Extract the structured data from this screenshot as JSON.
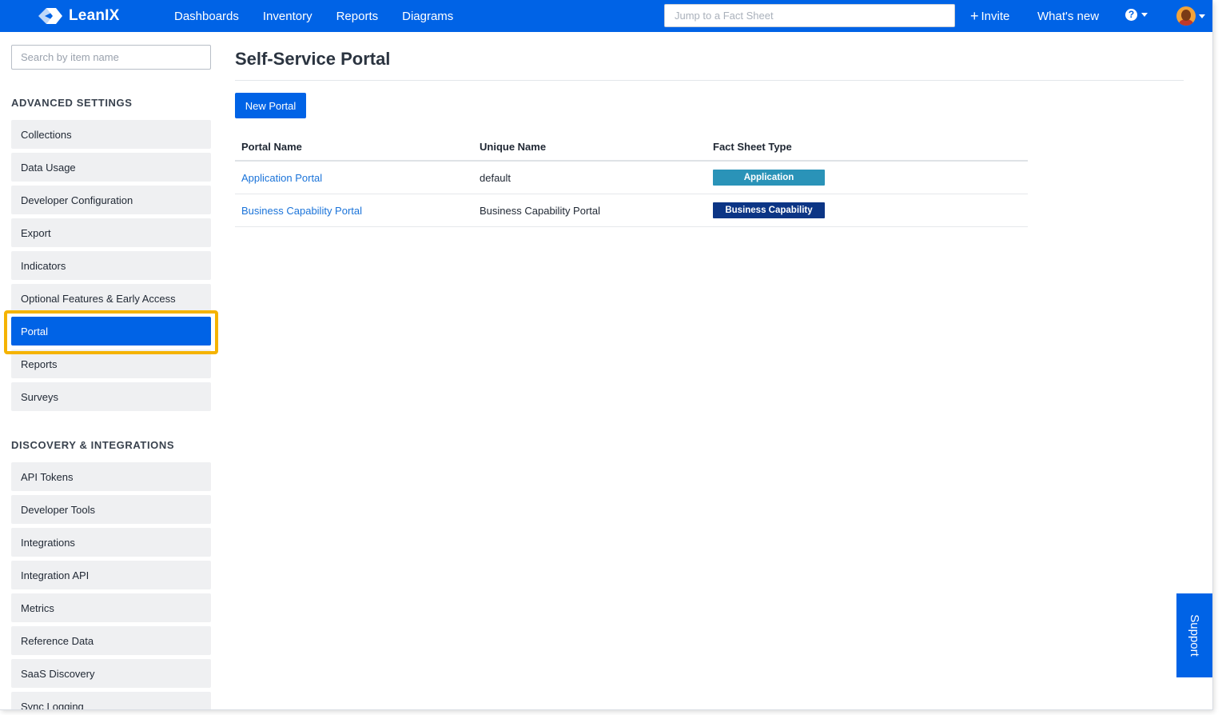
{
  "app": {
    "logo_text": "LeanIX",
    "nav": [
      "Dashboards",
      "Inventory",
      "Reports",
      "Diagrams"
    ],
    "jump_placeholder": "Jump to a Fact Sheet",
    "invite_label": "Invite",
    "whats_new_label": "What's new"
  },
  "sidebar": {
    "search_placeholder": "Search by item name",
    "section1_title": "ADVANCED SETTINGS",
    "section1_items": [
      "Collections",
      "Data Usage",
      "Developer Configuration",
      "Export",
      "Indicators",
      "Optional Features & Early Access",
      "Portal",
      "Reports",
      "Surveys"
    ],
    "active_item": "Portal",
    "section2_title": "DISCOVERY & INTEGRATIONS",
    "section2_items": [
      "API Tokens",
      "Developer Tools",
      "Integrations",
      "Integration API",
      "Metrics",
      "Reference Data",
      "SaaS Discovery",
      "Sync Logging"
    ]
  },
  "main": {
    "title": "Self-Service Portal",
    "new_button": "New Portal",
    "columns": [
      "Portal Name",
      "Unique Name",
      "Fact Sheet Type"
    ],
    "rows": [
      {
        "portal_name": "Application Portal",
        "unique_name": "default",
        "fact_sheet_type": "Application",
        "badge_color": "#2a93b8"
      },
      {
        "portal_name": "Business Capability Portal",
        "unique_name": "Business Capability Portal",
        "fact_sheet_type": "Business Capability",
        "badge_color": "#0c3585"
      }
    ]
  },
  "support_label": "Support",
  "colors": {
    "brand": "#0063e6",
    "highlight": "#f5b300"
  }
}
